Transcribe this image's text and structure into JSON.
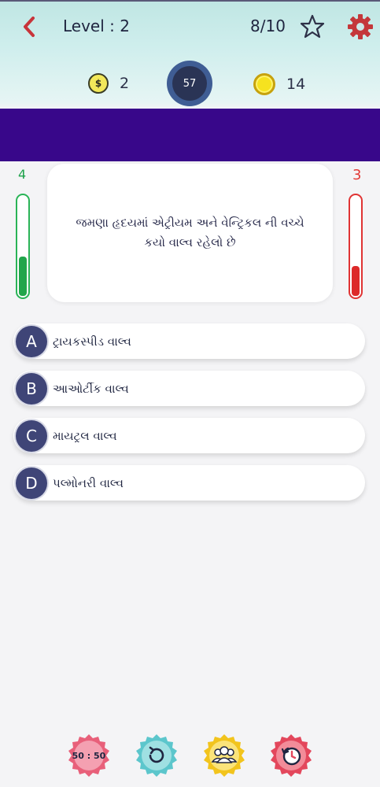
{
  "header": {
    "back_icon": "chevron-left-icon",
    "level_label": "Level : 2",
    "progress": "8/10",
    "favorite_icon": "star-icon",
    "settings_icon": "gear-icon"
  },
  "stats": {
    "dollars": "2",
    "timer": "57",
    "coins": "14"
  },
  "score": {
    "correct": "4",
    "wrong": "3",
    "correct_fill": 0.4,
    "wrong_fill": 0.3
  },
  "question": {
    "text": "જમણા હૃદયમાં એટ્રીયમ અને વેન્ટ્રિકલ ની વચ્ચે કયો વાલ્વ રહેલો છે"
  },
  "options": [
    {
      "letter": "A",
      "text": "ટ્રાયકસ્પીડ વાલ્વ"
    },
    {
      "letter": "B",
      "text": "આઓર્ટીક વાલ્વ"
    },
    {
      "letter": "C",
      "text": "માયટ્રલ વાલ્વ"
    },
    {
      "letter": "D",
      "text": "પલ્મોનરી વાલ્વ"
    }
  ],
  "lifelines": {
    "fifty_fifty": "50 : 50",
    "icons": [
      "fifty-fifty-icon",
      "refresh-icon",
      "audience-icon",
      "time-icon"
    ]
  },
  "colors": {
    "accent_purple": "#38078a",
    "correct_green": "#22a54b",
    "wrong_red": "#dd2a2a",
    "badge_navy": "#3f4577"
  }
}
